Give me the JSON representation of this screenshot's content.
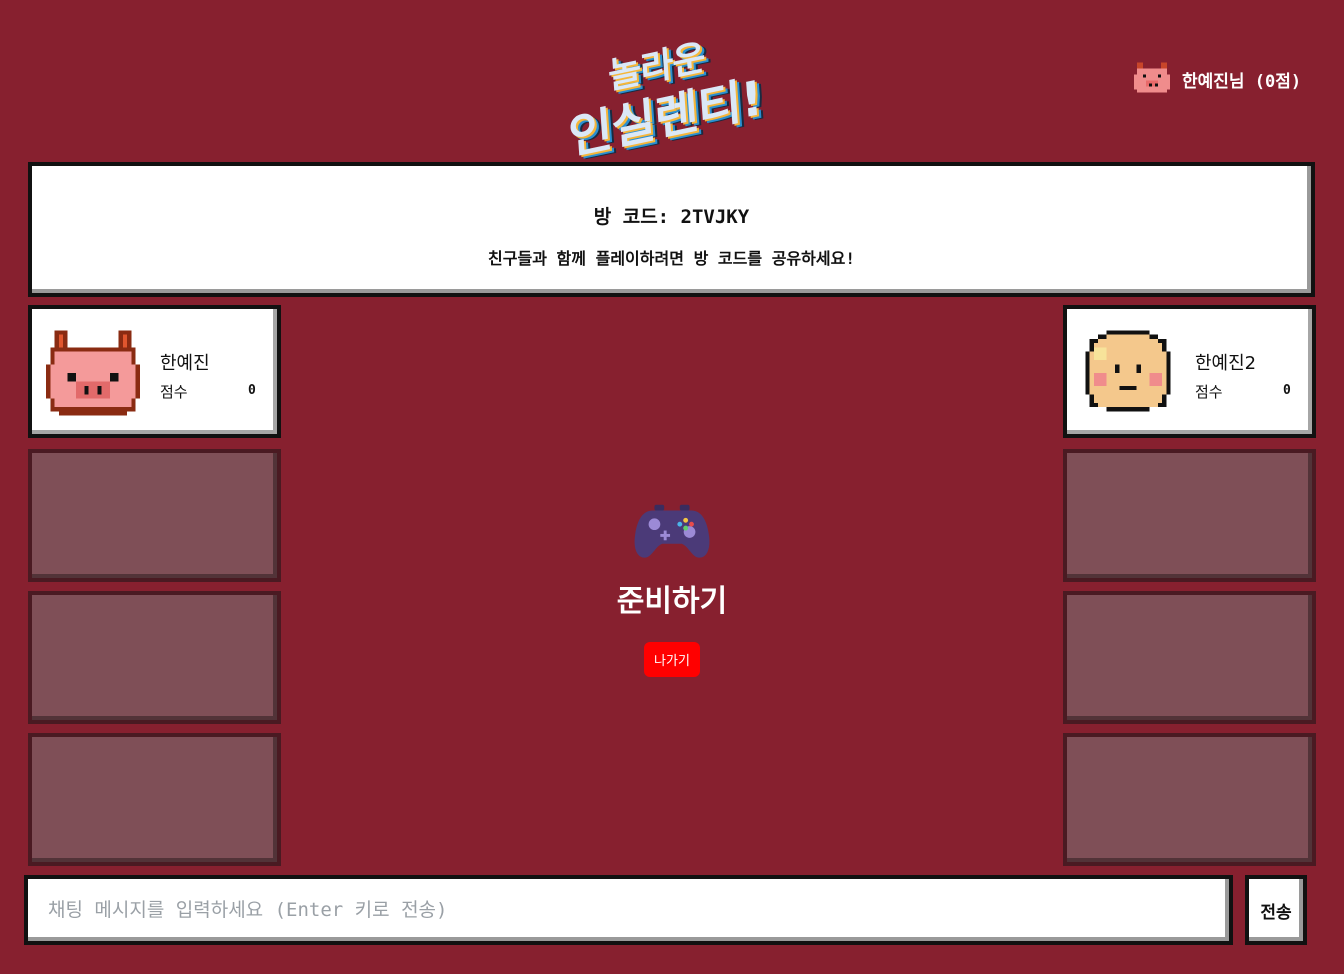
{
  "header": {
    "logo_line1": "놀라운",
    "logo_line2": "인실렌티!",
    "user_label": "한예진님 (0점)",
    "user_icon": "pig-icon"
  },
  "room": {
    "code_label": "방 코드: 2TVJKY",
    "hint": "친구들과 함께 플레이하려면 방 코드를 공유하세요!"
  },
  "players": [
    {
      "name": "한예진",
      "score_label": "점수",
      "score": "0",
      "avatar": "pig-avatar"
    },
    {
      "name": "한예진2",
      "score_label": "점수",
      "score": "0",
      "avatar": "face-avatar"
    }
  ],
  "center": {
    "icon": "game-controller-icon",
    "status": "준비하기",
    "leave_label": "나가기"
  },
  "chat": {
    "placeholder": "채팅 메시지를 입력하세요 (Enter 키로 전송)",
    "send_label": "전송"
  },
  "colors": {
    "background": "#87202f",
    "empty_slot": "#7f4f57",
    "leave_button": "#ff0000"
  }
}
